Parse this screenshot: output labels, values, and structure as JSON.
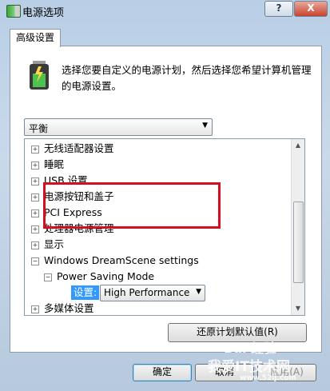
{
  "window": {
    "title": "电源选项",
    "help_label": "?",
    "close_label": "X"
  },
  "tab": {
    "label": "高级设置"
  },
  "description": "选择您要自定义的电源计划，然后选择您希望计算机管理的电源设置。",
  "plan_select": {
    "value": "平衡"
  },
  "tree": {
    "items": [
      {
        "label": "无线适配器设置",
        "expander": "+"
      },
      {
        "label": "睡眠",
        "expander": "+"
      },
      {
        "label": "USB 设置",
        "expander": "+"
      },
      {
        "label": "电源按钮和盖子",
        "expander": "+"
      },
      {
        "label": "PCI Express",
        "expander": "+"
      },
      {
        "label": "处理器电源管理",
        "expander": "+"
      },
      {
        "label": "显示",
        "expander": "+"
      },
      {
        "label": "Windows DreamScene settings",
        "expander": "−"
      },
      {
        "label": "Power Saving Mode",
        "expander": "−"
      },
      {
        "label": "多媒体设置",
        "expander": "+"
      }
    ],
    "setting_label": "设置:",
    "setting_value": "High Performance",
    "highlight_color": "#d3101f",
    "selection_color": "#3399ff"
  },
  "buttons": {
    "restore": "还原计划默认值(R)",
    "ok": "确定",
    "cancel": "取消",
    "apply": "应用(A)"
  },
  "watermark": {
    "line1": "Bai 经验",
    "line2": "我爱IT技术网",
    "line3": "www.52ij.com"
  }
}
